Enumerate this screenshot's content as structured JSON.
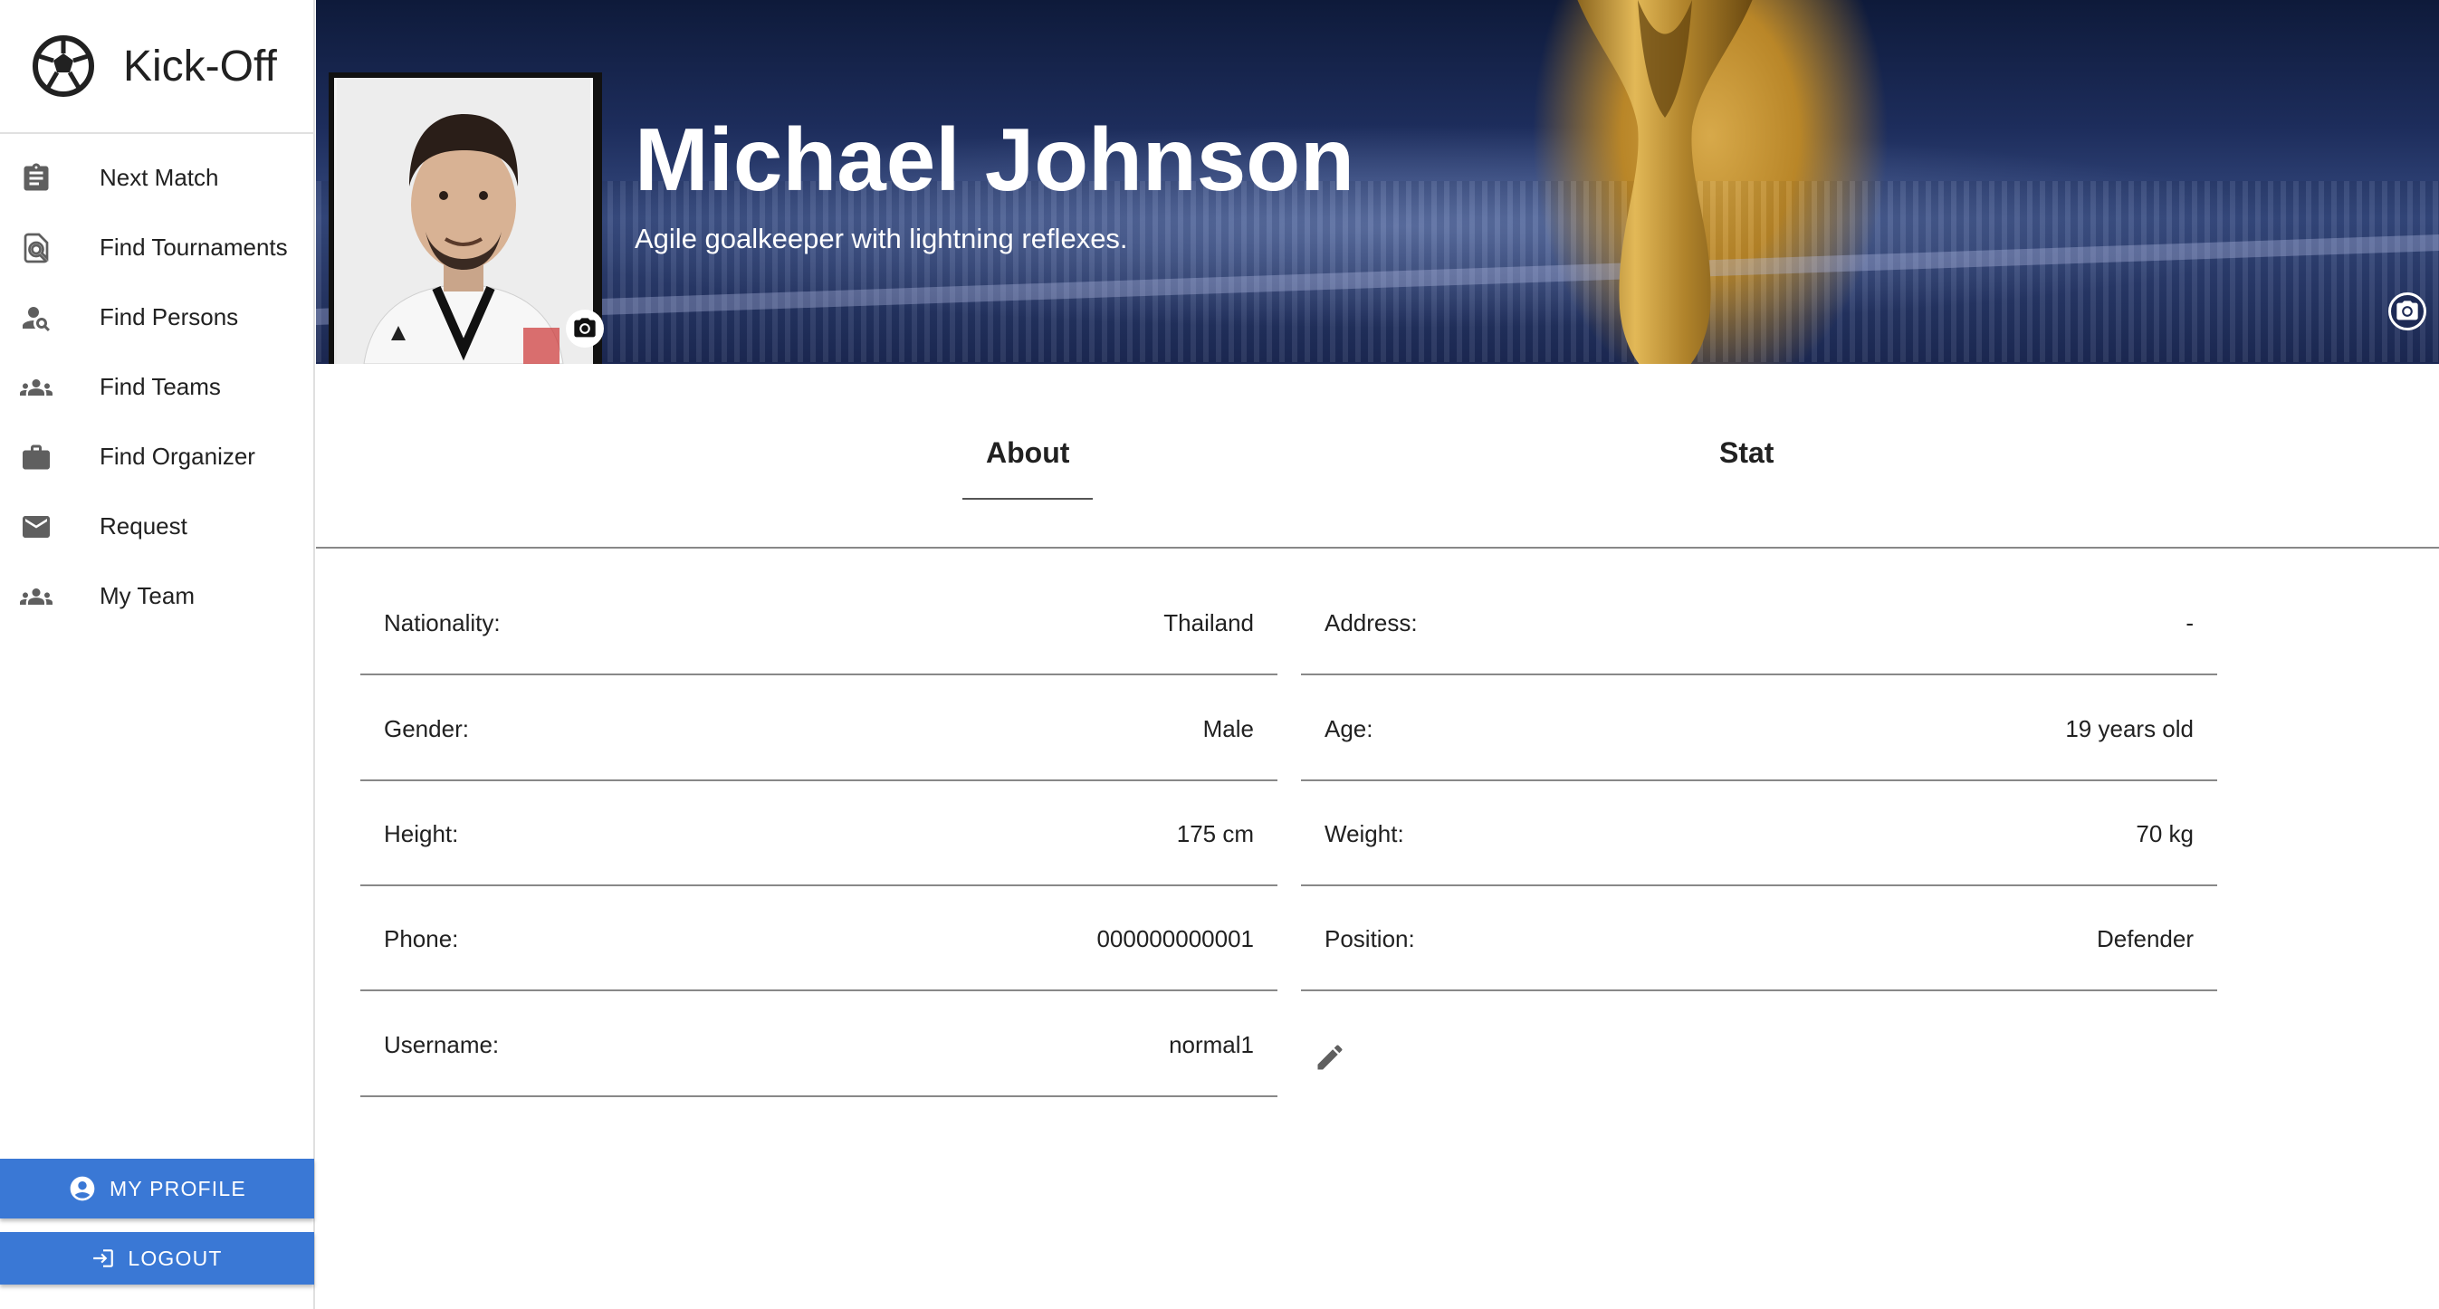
{
  "app": {
    "title": "Kick-Off"
  },
  "sidebar": {
    "items": [
      {
        "label": "Next Match",
        "icon": "clipboard-icon"
      },
      {
        "label": "Find Tournaments",
        "icon": "find-in-page-icon"
      },
      {
        "label": "Find Persons",
        "icon": "person-search-icon"
      },
      {
        "label": "Find Teams",
        "icon": "groups-icon"
      },
      {
        "label": "Find Organizer",
        "icon": "briefcase-icon"
      },
      {
        "label": "Request",
        "icon": "mail-icon"
      },
      {
        "label": "My Team",
        "icon": "people-icon"
      }
    ],
    "profile_button": "MY PROFILE",
    "logout_button": "LOGOUT"
  },
  "profile": {
    "name": "Michael Johnson",
    "bio": "Agile goalkeeper with lightning reflexes."
  },
  "tabs": [
    {
      "label": "About",
      "active": true
    },
    {
      "label": "Stat",
      "active": false
    }
  ],
  "info": {
    "nationality": {
      "label": "Nationality:",
      "value": "Thailand"
    },
    "address": {
      "label": "Address:",
      "value": "-"
    },
    "gender": {
      "label": "Gender:",
      "value": "Male"
    },
    "age": {
      "label": "Age:",
      "value": "19 years old"
    },
    "height": {
      "label": "Height:",
      "value": "175 cm"
    },
    "weight": {
      "label": "Weight:",
      "value": "70 kg"
    },
    "phone": {
      "label": "Phone:",
      "value": "000000000001"
    },
    "position": {
      "label": "Position:",
      "value": "Defender"
    },
    "username": {
      "label": "Username:",
      "value": "normal1"
    }
  },
  "colors": {
    "primary": "#3a78d5",
    "icon_gray": "#5f5f5f"
  }
}
